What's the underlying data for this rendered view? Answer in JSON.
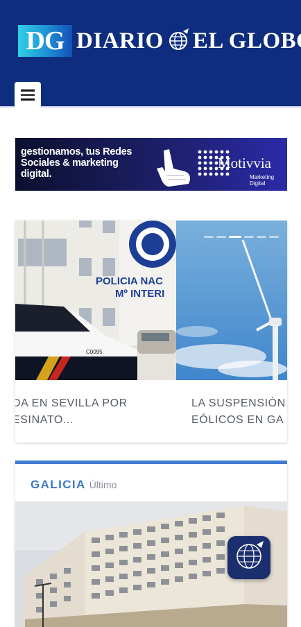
{
  "header": {
    "logo_mark": "DG",
    "logo_text_left": "DIARIO",
    "logo_text_right": "EL GLOBO",
    "menu_icon": "hamburger-menu-icon"
  },
  "ad": {
    "text": "gestionamos, tus Redes Sociales & marketing digital.",
    "brand": "Motivvia",
    "tagline": "Marketing Digital"
  },
  "slider": {
    "slides": [
      {
        "caption_line1": "DA EN SEVILLA POR",
        "caption_line2": "ESINATO...",
        "sign_line1": "POLICIA NAC",
        "sign_line2": "Mº INTERI"
      },
      {
        "caption_line1": "LA SUSPENSIÓN",
        "caption_line2": "EÓLICOS EN GA"
      }
    ],
    "active_dot": 2,
    "dot_count": 6
  },
  "section": {
    "title": "GALICIA",
    "subtitle": "Último",
    "accent_color": "#3f7bd1"
  },
  "colors": {
    "header_bg": "#0f2d7e",
    "ad_bg": "#1a1d5e",
    "caption_text": "#555b66"
  }
}
